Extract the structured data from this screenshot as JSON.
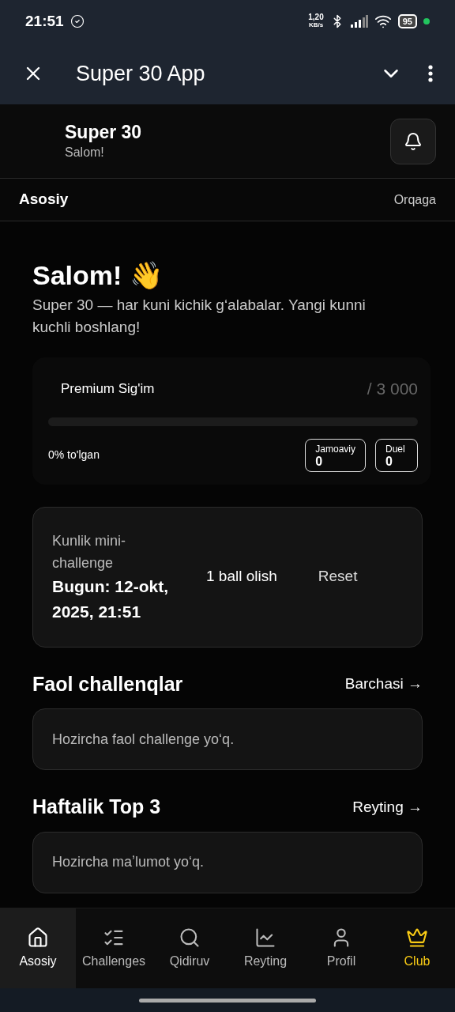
{
  "status_bar": {
    "time": "21:51",
    "net_speed": "1,20",
    "net_unit": "KB/s",
    "battery": "95"
  },
  "app_bar": {
    "title": "Super 30 App"
  },
  "header": {
    "title": "Super 30",
    "subtitle": "Salom!"
  },
  "breadcrumb": {
    "title": "Asosiy",
    "back": "Orqaga"
  },
  "hero": {
    "title": "Salom! 👋",
    "text": "Super 30 — har kuni kichik gʻalabalar. Yangi kunni kuchli boshlang!"
  },
  "capacity": {
    "title": "Premium Sig'im",
    "total": "/ 3 000",
    "level": 0,
    "percent": "0% to'lgan",
    "stats": [
      {
        "label": "Jamoaviy",
        "value": "0"
      },
      {
        "label": "Duel",
        "value": "0"
      }
    ]
  },
  "daily": {
    "label": "Kunlik mini-challenge",
    "date": "Bugun: 12-okt, 2025, 21:51",
    "action": "1 ball olish",
    "reset": "Reset"
  },
  "sections": [
    {
      "title": "Faol challenqlar",
      "link": "Barchasi →",
      "empty": "Hozircha faol challenge yoʻq."
    },
    {
      "title": "Haftalik Top 3",
      "link": "Reyting →",
      "empty": "Hozircha maʼlumot yoʻq."
    }
  ],
  "nav": [
    {
      "label": "Asosiy",
      "selected": true,
      "kind": "tab"
    },
    {
      "label": "Challenges",
      "selected": false,
      "kind": "tab"
    },
    {
      "label": "Qidiruv",
      "selected": false,
      "kind": "tab"
    },
    {
      "label": "Reyting",
      "selected": false,
      "kind": "tab"
    },
    {
      "label": "Profil",
      "selected": false,
      "kind": "tab"
    },
    {
      "label": "Club",
      "selected": false,
      "kind": "club"
    }
  ]
}
